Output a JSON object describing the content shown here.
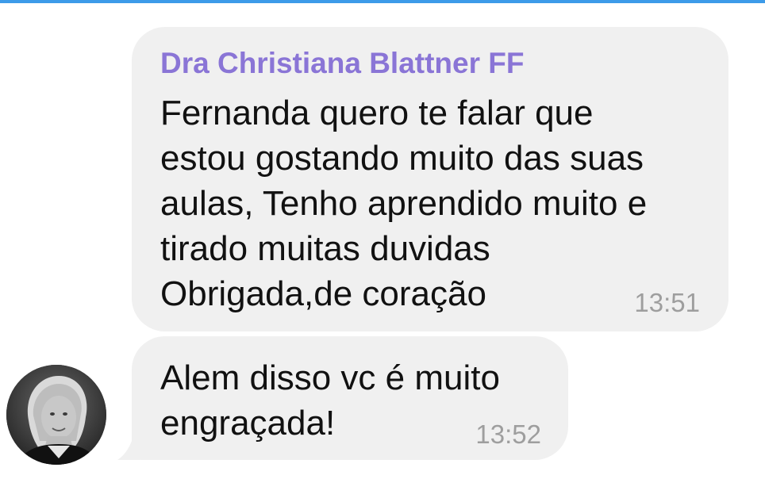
{
  "chat": {
    "messages": [
      {
        "sender": "Dra Christiana Blattner FF",
        "lines": [
          "Fernanda quero te falar que",
          "estou gostando muito das suas",
          "aulas, Tenho aprendido muito e",
          "tirado muitas duvidas",
          "Obrigada,de coração"
        ],
        "time": "13:51"
      },
      {
        "lines": [
          "Alem disso vc é muito",
          "engraçada!"
        ],
        "time": "13:52"
      }
    ]
  },
  "colors": {
    "accent_bar": "#3d9be9",
    "bubble_bg": "#f0f0f0",
    "sender_name": "#8a75d6",
    "message_text": "#111111",
    "timestamp": "#9e9e9e"
  },
  "icons": {
    "avatar": "user-avatar-photo"
  }
}
